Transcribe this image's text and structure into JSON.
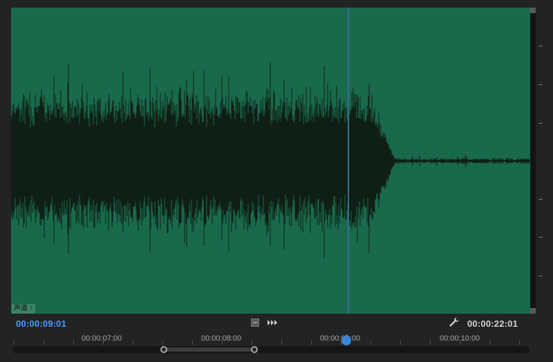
{
  "app": {
    "panel": "audio-waveform-monitor"
  },
  "channel": {
    "label": "声道",
    "number": "1"
  },
  "timecode": {
    "current": "00:00:09:01",
    "duration": "00:00:22:01"
  },
  "ruler": {
    "labels": [
      "00:00:07:00",
      "00:00:08:00",
      "00:00:09:00",
      "00:00:10:00"
    ]
  },
  "playback": {
    "playhead_time": "00:00:09:00"
  },
  "colors": {
    "waveform_background": "#196a4d",
    "waveform_fill": "#0f1f17",
    "current_timecode": "#4a9bff",
    "playhead": "#3a86d8"
  },
  "icons": {
    "mark_in": "mark-in-icon",
    "step_forward": "step-forward-icon",
    "settings": "wrench-icon",
    "playhead": "playhead-marker-icon"
  }
}
